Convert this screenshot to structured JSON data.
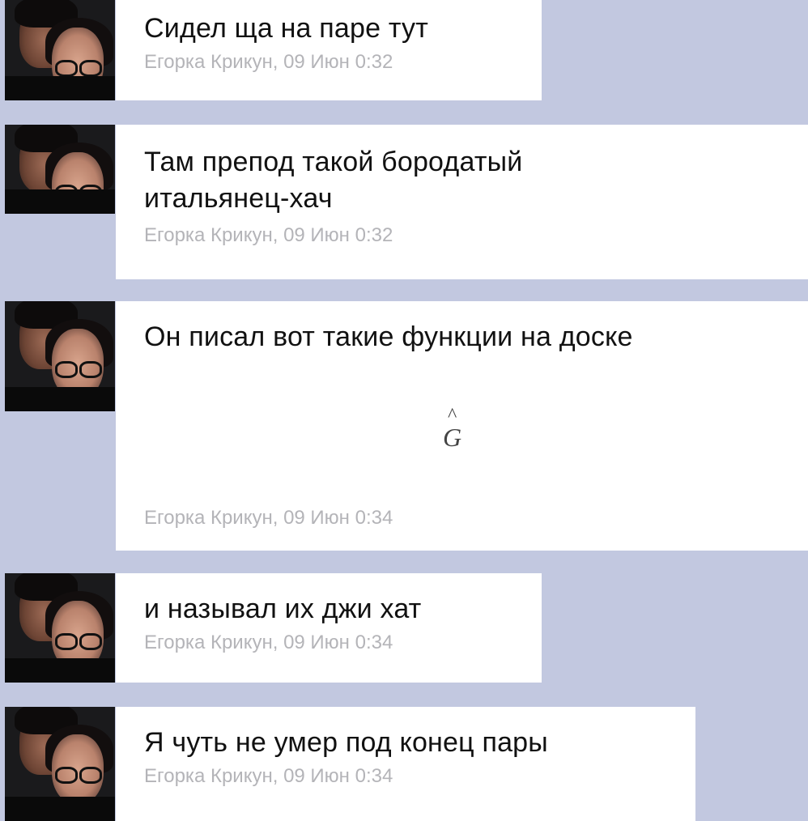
{
  "messages": [
    {
      "text": "Сидел ща на паре тут",
      "author": "Егорка Крикун, 09 Июн 0:32"
    },
    {
      "text": "Там препод такой бородатый итальянец-хач",
      "author": "Егорка Крикун, 09 Июн 0:32"
    },
    {
      "text": "Он писал вот такие функции на доске",
      "formula": "G",
      "formula_accent": "^",
      "author": "Егорка Крикун, 09 Июн 0:34"
    },
    {
      "text": "и называл их джи хат",
      "author": "Егорка Крикун, 09 Июн 0:34"
    },
    {
      "text": "Я чуть не умер под конец пары",
      "author": "Егорка Крикун, 09 Июн 0:34"
    }
  ]
}
